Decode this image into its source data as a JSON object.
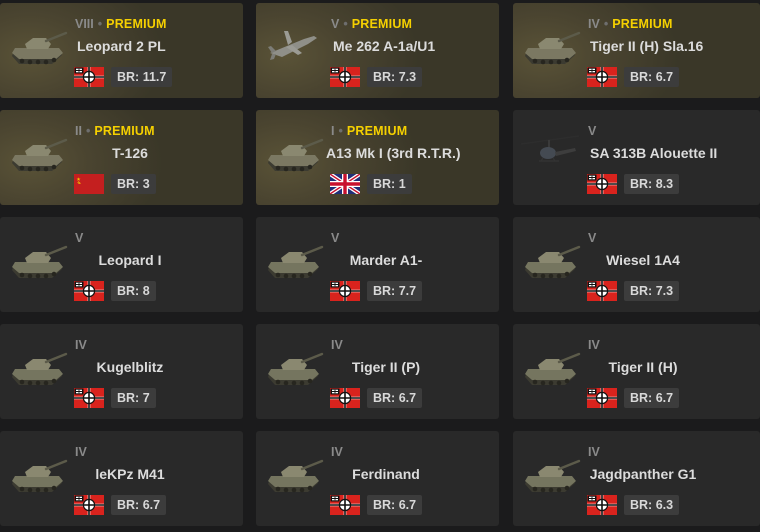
{
  "colors": {
    "page_bg": "#1b1b1c",
    "card_bg": "#292929",
    "premium_bg": "#4a4430",
    "premium_text": "#f5d000",
    "br_badge_bg": "#3c3c3c"
  },
  "vehicles": [
    {
      "rank": "VIII",
      "premium": true,
      "premium_label": "PREMIUM",
      "name": "Leopard 2 PL",
      "country": "germany",
      "br": "BR: 11.7",
      "icon": "tank-icon"
    },
    {
      "rank": "V",
      "premium": true,
      "premium_label": "PREMIUM",
      "name": "Me 262 A-1a/U1",
      "country": "germany",
      "br": "BR: 7.3",
      "icon": "jet-icon"
    },
    {
      "rank": "IV",
      "premium": true,
      "premium_label": "PREMIUM",
      "name": "Tiger II (H) Sla.16",
      "country": "germany",
      "br": "BR: 6.7",
      "icon": "tank-icon"
    },
    {
      "rank": "II",
      "premium": true,
      "premium_label": "PREMIUM",
      "name": "T-126",
      "country": "ussr",
      "br": "BR: 3",
      "icon": "tank-icon"
    },
    {
      "rank": "I",
      "premium": true,
      "premium_label": "PREMIUM",
      "name": "A13 Mk I (3rd R.T.R.)",
      "country": "uk",
      "br": "BR: 1",
      "icon": "tank-icon"
    },
    {
      "rank": "V",
      "premium": false,
      "premium_label": "",
      "name": "SA 313B Alouette II",
      "country": "germany",
      "br": "BR: 8.3",
      "icon": "helicopter-icon"
    },
    {
      "rank": "V",
      "premium": false,
      "premium_label": "",
      "name": "Leopard I",
      "country": "germany",
      "br": "BR: 8",
      "icon": "tank-icon"
    },
    {
      "rank": "V",
      "premium": false,
      "premium_label": "",
      "name": "Marder A1-",
      "country": "germany",
      "br": "BR: 7.7",
      "icon": "tank-icon"
    },
    {
      "rank": "V",
      "premium": false,
      "premium_label": "",
      "name": "Wiesel 1A4",
      "country": "germany",
      "br": "BR: 7.3",
      "icon": "tank-icon"
    },
    {
      "rank": "IV",
      "premium": false,
      "premium_label": "",
      "name": "Kugelblitz",
      "country": "germany",
      "br": "BR: 7",
      "icon": "tank-icon"
    },
    {
      "rank": "IV",
      "premium": false,
      "premium_label": "",
      "name": "Tiger II (P)",
      "country": "germany",
      "br": "BR: 6.7",
      "icon": "tank-icon"
    },
    {
      "rank": "IV",
      "premium": false,
      "premium_label": "",
      "name": "Tiger II (H)",
      "country": "germany",
      "br": "BR: 6.7",
      "icon": "tank-icon"
    },
    {
      "rank": "IV",
      "premium": false,
      "premium_label": "",
      "name": "leKPz M41",
      "country": "germany",
      "br": "BR: 6.7",
      "icon": "tank-icon"
    },
    {
      "rank": "IV",
      "premium": false,
      "premium_label": "",
      "name": "Ferdinand",
      "country": "germany",
      "br": "BR: 6.7",
      "icon": "tank-icon"
    },
    {
      "rank": "IV",
      "premium": false,
      "premium_label": "",
      "name": "Jagdpanther G1",
      "country": "germany",
      "br": "BR: 6.3",
      "icon": "tank-icon"
    }
  ]
}
